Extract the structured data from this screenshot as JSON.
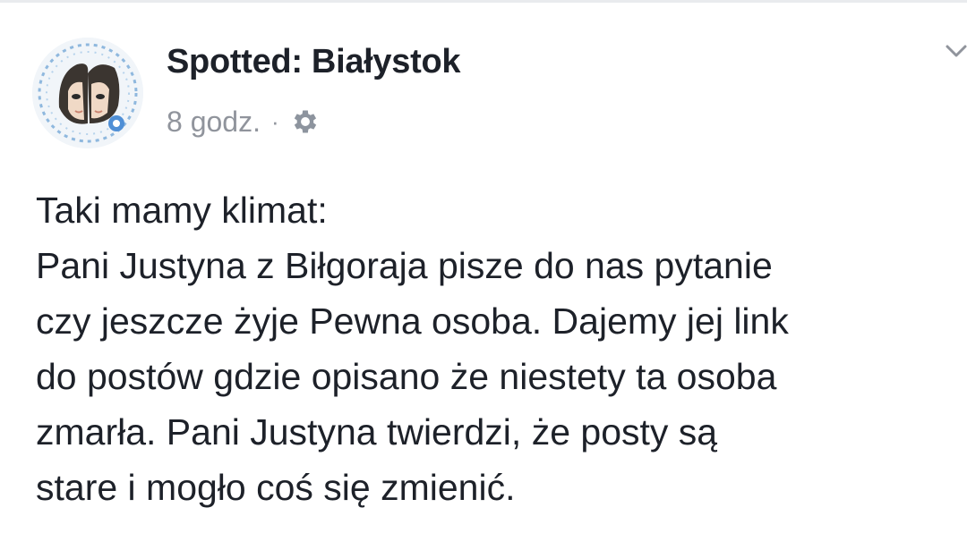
{
  "post": {
    "page_name": "Spotted: Białystok",
    "timestamp": "8 godz.",
    "separator": "·",
    "privacy_icon": "gear-icon",
    "avatar_icon": "page-avatar-illustration",
    "menu_icon": "chevron-down-icon",
    "text_lines": [
      "Taki mamy klimat:",
      "Pani Justyna z Biłgoraja pisze do nas pytanie",
      "czy jeszcze żyje Pewna osoba. Dajemy jej link",
      "do postów gdzie opisano że niestety ta osoba",
      "zmarła. Pani Justyna twierdzi, że posty są",
      "stare i mogło coś się zmienić."
    ]
  },
  "colors": {
    "text": "#1d2129",
    "meta_text": "#90949c",
    "background": "#ffffff"
  }
}
